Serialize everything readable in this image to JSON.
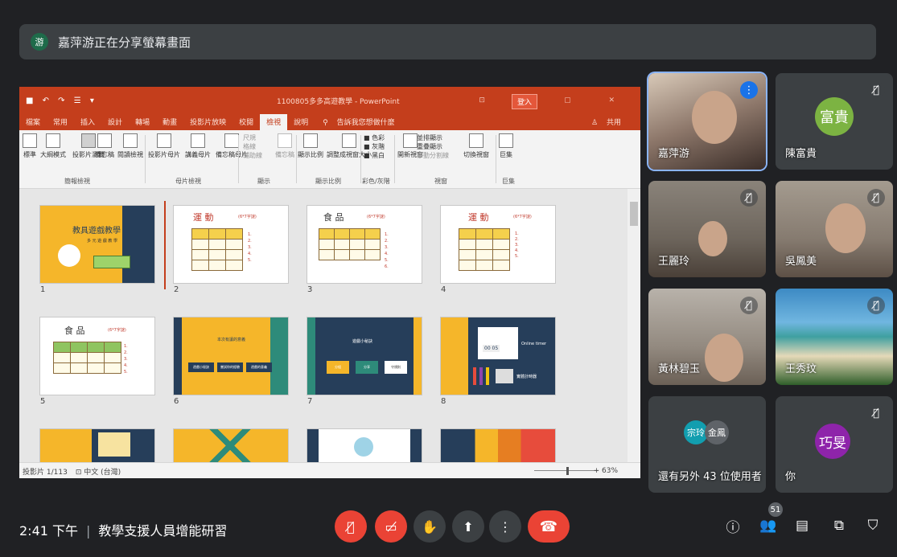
{
  "banner": {
    "avatar_letter": "游",
    "text": "嘉萍游正在分享螢幕畫面"
  },
  "ppt": {
    "doc_title": "1100805多多高遊教學 - PowerPoint",
    "login": "登入",
    "tabs": [
      "檔案",
      "常用",
      "插入",
      "設計",
      "轉場",
      "動畫",
      "投影片放映",
      "校閱",
      "檢視",
      "說明"
    ],
    "selected_tab": "檢視",
    "tell_me": "告訴我您想做什麼",
    "share": "共用",
    "ribbon": {
      "buttons": [
        "標準",
        "大綱模式",
        "投影片瀏覽",
        "備忘稿",
        "閱讀檢視",
        "投影片母片",
        "講義母片",
        "備忘稿母片",
        "尺規",
        "格線",
        "輔助線",
        "備忘稿",
        "顯示比例",
        "調整成視窗大小",
        "色彩",
        "灰階",
        "黑白",
        "開新視窗",
        "並排顯示",
        "重疊顯示",
        "移動分割線",
        "切換視窗",
        "巨集"
      ],
      "groups": [
        "簡報檢視",
        "母片檢視",
        "顯示",
        "顯示比例",
        "彩色/灰階",
        "視窗",
        "巨集"
      ]
    },
    "slides": [
      {
        "num": "1",
        "title": "教具遊戲教學",
        "sub": "多 元 遊 戲 教 學"
      },
      {
        "num": "2",
        "title": "運  動",
        "tag": "(6*7字謎)",
        "cells": [
          "腳",
          "踏",
          "野",
          "跑",
          "馬",
          "觀",
          "相",
          "球",
          "拆",
          "球",
          "跤",
          "傀"
        ]
      },
      {
        "num": "3",
        "title": "食  品",
        "tag": "(6*7字謎)",
        "cells": [
          "麵",
          "包",
          "樹",
          "茶",
          "菇",
          "糖",
          "蔥",
          "麵",
          "割",
          "麻",
          "蕉",
          "麥"
        ]
      },
      {
        "num": "4",
        "title": "運  動",
        "tag": "(6*7字謎)",
        "cells": [
          "腳",
          "踏",
          "野",
          "跑",
          "馬",
          "觀",
          "相",
          "球",
          "拆",
          "球",
          "跤",
          "傀"
        ]
      },
      {
        "num": "5",
        "title": "食  品",
        "tag": "(6*7字謎)",
        "cells": [
          "麵",
          "包",
          "樹",
          "茶",
          "菇",
          "糖",
          "蔥",
          "麵",
          "割",
          "麻",
          "蕉",
          "麥"
        ]
      },
      {
        "num": "6",
        "title": "本次有讓的意義",
        "boxes": [
          "遊戲小秘訣",
          "嘗試你的經驗",
          "遊戲的意義"
        ]
      },
      {
        "num": "7",
        "title": "遊戲小秘訣",
        "boxes": [
          "分組",
          "分享",
          "守規則"
        ]
      },
      {
        "num": "8",
        "title": "Online timer",
        "timer": "00 05",
        "sub": "實體計時器"
      }
    ],
    "status": {
      "slide": "投影片 1/113",
      "lang": "中文 (台灣)",
      "zoom": "+ 63%"
    }
  },
  "participants": [
    {
      "name": "嘉萍游",
      "speaking": true
    },
    {
      "name": "陳富貴",
      "avatar_text": "富貴",
      "avatar_color": "#7cb342",
      "muted": true
    },
    {
      "name": "王麗玲",
      "muted": true
    },
    {
      "name": "吳鳳美",
      "muted": true
    },
    {
      "name": "黃林碧玉",
      "muted": true
    },
    {
      "name": "王秀玟",
      "muted": true
    },
    {
      "others_label": "還有另外 43 位使用者",
      "mini_avatars": [
        {
          "text": "宗玲",
          "color": "#129eaf"
        },
        {
          "text": "金鳳",
          "color": "#5f6368"
        }
      ]
    },
    {
      "name": "你",
      "avatar_text": "巧旻",
      "avatar_color": "#8e24aa",
      "muted": true
    }
  ],
  "bottom": {
    "time": "2:41 下午",
    "meeting": "教學支援人員增能研習",
    "people_count": "51"
  },
  "colors": {
    "red": "#ea4335",
    "tile": "#3c4043",
    "bg": "#202124"
  }
}
